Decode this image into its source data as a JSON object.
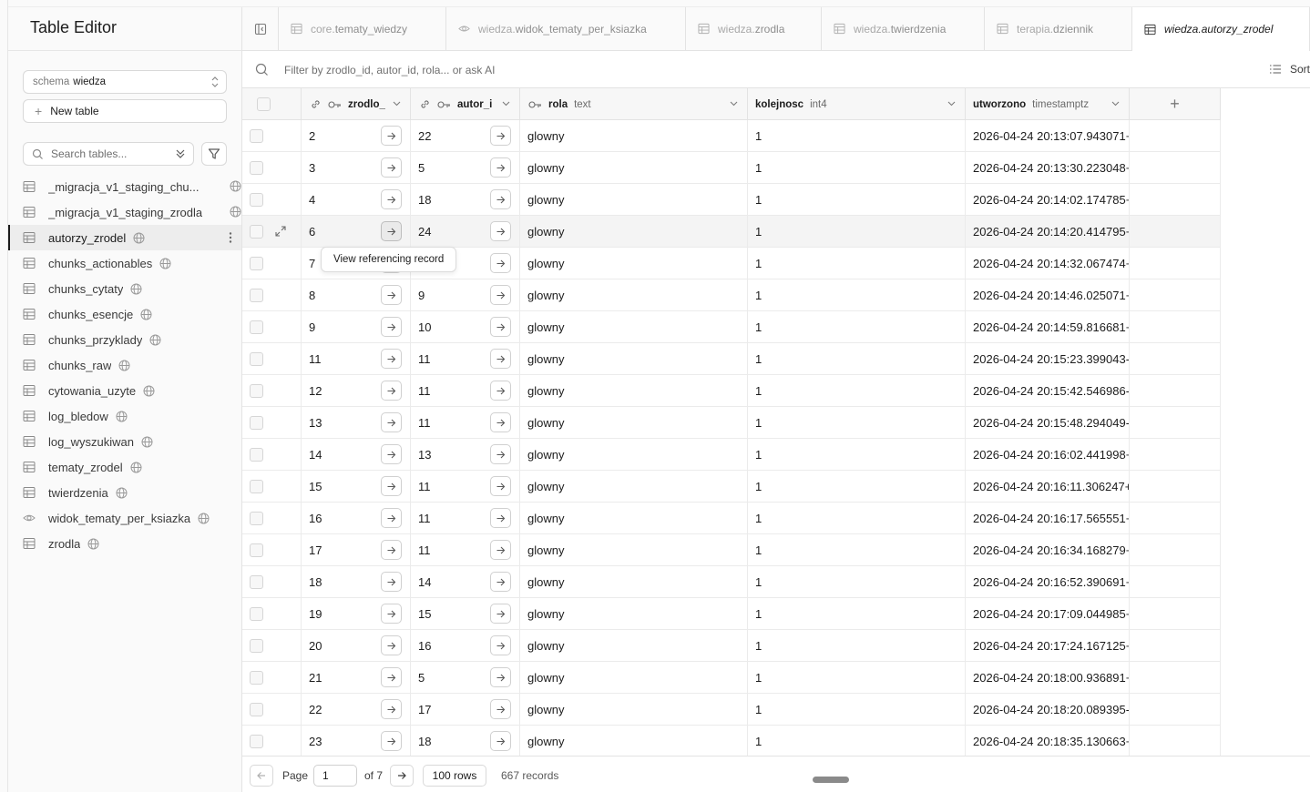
{
  "sidebar": {
    "title": "Table Editor",
    "schema_label": "schema",
    "schema_value": "wiedza",
    "new_table_label": "New table",
    "search_placeholder": "Search tables...",
    "tables": [
      {
        "name": "_migracja_v1_staging_chu...",
        "kind": "table",
        "active": false
      },
      {
        "name": "_migracja_v1_staging_zrodla",
        "kind": "table",
        "active": false
      },
      {
        "name": "autorzy_zrodel",
        "kind": "table",
        "active": true
      },
      {
        "name": "chunks_actionables",
        "kind": "table",
        "active": false
      },
      {
        "name": "chunks_cytaty",
        "kind": "table",
        "active": false
      },
      {
        "name": "chunks_esencje",
        "kind": "table",
        "active": false
      },
      {
        "name": "chunks_przyklady",
        "kind": "table",
        "active": false
      },
      {
        "name": "chunks_raw",
        "kind": "table",
        "active": false
      },
      {
        "name": "cytowania_uzyte",
        "kind": "table",
        "active": false
      },
      {
        "name": "log_bledow",
        "kind": "table",
        "active": false
      },
      {
        "name": "log_wyszukiwan",
        "kind": "table",
        "active": false
      },
      {
        "name": "tematy_zrodel",
        "kind": "table",
        "active": false
      },
      {
        "name": "twierdzenia",
        "kind": "table",
        "active": false
      },
      {
        "name": "widok_tematy_per_ksiazka",
        "kind": "view",
        "active": false
      },
      {
        "name": "zrodla",
        "kind": "table",
        "active": false
      }
    ]
  },
  "tabs": [
    {
      "schema": "core.",
      "table": "tematy_wiedzy",
      "kind": "table",
      "active": false
    },
    {
      "schema": "wiedza.",
      "table": "widok_tematy_per_ksiazka",
      "kind": "view",
      "active": false
    },
    {
      "schema": "wiedza.",
      "table": "zrodla",
      "kind": "table",
      "active": false
    },
    {
      "schema": "wiedza.",
      "table": "twierdzenia",
      "kind": "table",
      "active": false
    },
    {
      "schema": "terapia.",
      "table": "dziennik",
      "kind": "table",
      "active": false
    },
    {
      "schema": "wiedza.",
      "table": "autorzy_zrodel",
      "kind": "table",
      "active": true
    }
  ],
  "filter": {
    "placeholder": "Filter by zrodlo_id, autor_id, rola... or ask AI",
    "sort_label": "Sort"
  },
  "columns": [
    {
      "name": "zrodlo_",
      "type": ""
    },
    {
      "name": "autor_i",
      "type": ""
    },
    {
      "name": "rola",
      "type": "text"
    },
    {
      "name": "kolejnosc",
      "type": "int4"
    },
    {
      "name": "utworzono",
      "type": "timestamptz"
    }
  ],
  "rows": [
    {
      "zrodlo": "2",
      "autor": "22",
      "rola": "glowny",
      "kolejnosc": "1",
      "utworzono": "2026-04-24 20:13:07.943071+"
    },
    {
      "zrodlo": "3",
      "autor": "5",
      "rola": "glowny",
      "kolejnosc": "1",
      "utworzono": "2026-04-24 20:13:30.223048+"
    },
    {
      "zrodlo": "4",
      "autor": "18",
      "rola": "glowny",
      "kolejnosc": "1",
      "utworzono": "2026-04-24 20:14:02.174785+0"
    },
    {
      "zrodlo": "6",
      "autor": "24",
      "rola": "glowny",
      "kolejnosc": "1",
      "utworzono": "2026-04-24 20:14:20.414795+"
    },
    {
      "zrodlo": "7",
      "autor": "",
      "rola": "glowny",
      "kolejnosc": "1",
      "utworzono": "2026-04-24 20:14:32.067474+"
    },
    {
      "zrodlo": "8",
      "autor": "9",
      "rola": "glowny",
      "kolejnosc": "1",
      "utworzono": "2026-04-24 20:14:46.025071+"
    },
    {
      "zrodlo": "9",
      "autor": "10",
      "rola": "glowny",
      "kolejnosc": "1",
      "utworzono": "2026-04-24 20:14:59.816681+0"
    },
    {
      "zrodlo": "11",
      "autor": "11",
      "rola": "glowny",
      "kolejnosc": "1",
      "utworzono": "2026-04-24 20:15:23.399043-"
    },
    {
      "zrodlo": "12",
      "autor": "11",
      "rola": "glowny",
      "kolejnosc": "1",
      "utworzono": "2026-04-24 20:15:42.546986-"
    },
    {
      "zrodlo": "13",
      "autor": "11",
      "rola": "glowny",
      "kolejnosc": "1",
      "utworzono": "2026-04-24 20:15:48.294049-"
    },
    {
      "zrodlo": "14",
      "autor": "13",
      "rola": "glowny",
      "kolejnosc": "1",
      "utworzono": "2026-04-24 20:16:02.441998+"
    },
    {
      "zrodlo": "15",
      "autor": "11",
      "rola": "glowny",
      "kolejnosc": "1",
      "utworzono": "2026-04-24 20:16:11.306247+("
    },
    {
      "zrodlo": "16",
      "autor": "11",
      "rola": "glowny",
      "kolejnosc": "1",
      "utworzono": "2026-04-24 20:16:17.565551+("
    },
    {
      "zrodlo": "17",
      "autor": "11",
      "rola": "glowny",
      "kolejnosc": "1",
      "utworzono": "2026-04-24 20:16:34.168279+"
    },
    {
      "zrodlo": "18",
      "autor": "14",
      "rola": "glowny",
      "kolejnosc": "1",
      "utworzono": "2026-04-24 20:16:52.390691+"
    },
    {
      "zrodlo": "19",
      "autor": "15",
      "rola": "glowny",
      "kolejnosc": "1",
      "utworzono": "2026-04-24 20:17:09.044985+"
    },
    {
      "zrodlo": "20",
      "autor": "16",
      "rola": "glowny",
      "kolejnosc": "1",
      "utworzono": "2026-04-24 20:17:24.167125+("
    },
    {
      "zrodlo": "21",
      "autor": "5",
      "rola": "glowny",
      "kolejnosc": "1",
      "utworzono": "2026-04-24 20:18:00.936891+"
    },
    {
      "zrodlo": "22",
      "autor": "17",
      "rola": "glowny",
      "kolejnosc": "1",
      "utworzono": "2026-04-24 20:18:20.089395-"
    },
    {
      "zrodlo": "23",
      "autor": "18",
      "rola": "glowny",
      "kolejnosc": "1",
      "utworzono": "2026-04-24 20:18:35.130663+"
    }
  ],
  "tooltip": "View referencing record",
  "footer": {
    "page_label": "Page",
    "page_value": "1",
    "of_label": "of 7",
    "rows_label": "100 rows",
    "records_label": "667 records"
  }
}
